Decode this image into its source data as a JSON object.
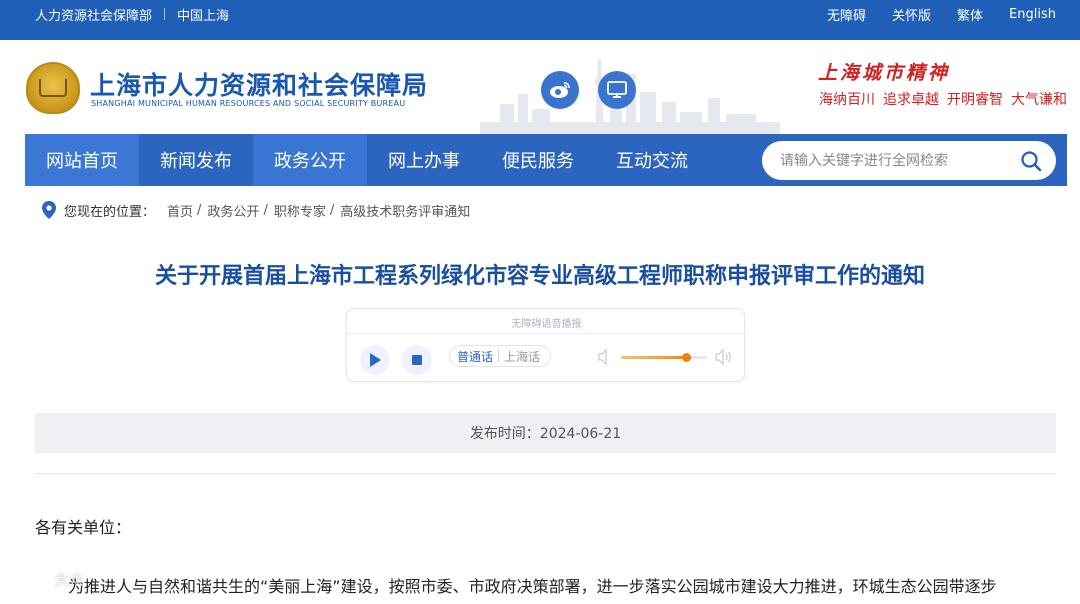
{
  "topbar": {
    "left": [
      "人力资源社会保障部",
      "中国上海"
    ],
    "right": [
      "无障碍",
      "关怀版",
      "繁体",
      "English"
    ]
  },
  "header": {
    "title": "上海市人力资源和社会保障局",
    "subtitle": "SHANGHAI MUNICIPAL HUMAN RESOURCES AND SOCIAL SECURITY BUREAU",
    "slogan_title": "上海城市精神",
    "slogans": [
      "海纳百川",
      "追求卓越",
      "开明睿智",
      "大气谦和"
    ]
  },
  "nav": {
    "items": [
      "网站首页",
      "新闻发布",
      "政务公开",
      "网上办事",
      "便民服务",
      "互动交流"
    ],
    "search_placeholder": "请输入关键字进行全网检索"
  },
  "breadcrumb": {
    "label": "您现在的位置：",
    "items": [
      "首页",
      "政务公开",
      "职称专家",
      "高级技术职务评审通知"
    ]
  },
  "article": {
    "title": "关于开展首届上海市工程系列绿化市容专业高级工程师职称申报评审工作的通知",
    "publish": "发布时间：2024-06-21",
    "salutation": "各有关单位：",
    "first_line": "为推进人与自然和谐共生的“美丽上海”建设，按照市委、市政府决策部署，进一步落实公园城市建设大力推进，环城生态公园带逐步"
  },
  "player": {
    "label": "无障碍语音播报",
    "lang_a": "普通话",
    "lang_b": "上海话",
    "volume": 0.75
  },
  "watermark": "大众"
}
